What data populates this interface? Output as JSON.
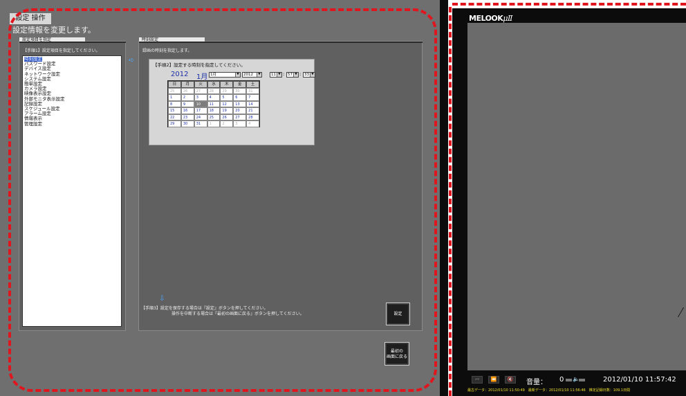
{
  "app": {
    "title": "設定 操作",
    "subtitle": "設定情報を変更します。"
  },
  "left_panel": {
    "tab": "設定項目を指定",
    "instruction": "【手順1】設定項目を指定してください。",
    "items": [
      "時刻設定",
      "パスワード設定",
      "デバイス設定",
      "ネットワーク設定",
      "システム設定",
      "簡単設定",
      "カメラ設定",
      "映像表示設定",
      "外部モニタ表示設定",
      "記録設定",
      "スケジュール設定",
      "アラーム設定",
      "情報表示",
      "管理設定"
    ],
    "selected_index": 0
  },
  "right_panel": {
    "tab": "時刻設定",
    "instruction": "録画の時刻を指定します。",
    "datetime": {
      "instruction": "【手順2】設定する時刻を指定してください。",
      "year": "2012",
      "month_label": "1月",
      "month_select": "1月",
      "year_select": "2012",
      "hour": "11",
      "minute": "57",
      "second": "33"
    },
    "calendar": {
      "weekdays": [
        "日",
        "月",
        "火",
        "水",
        "木",
        "金",
        "土"
      ],
      "weeks": [
        [
          "25",
          "26",
          "27",
          "28",
          "29",
          "30",
          "31"
        ],
        [
          "1",
          "2",
          "3",
          "4",
          "5",
          "6",
          "7"
        ],
        [
          "8",
          "9",
          "10",
          "11",
          "12",
          "13",
          "14"
        ],
        [
          "15",
          "16",
          "17",
          "18",
          "19",
          "20",
          "21"
        ],
        [
          "22",
          "23",
          "24",
          "25",
          "26",
          "27",
          "28"
        ],
        [
          "29",
          "30",
          "31",
          "1",
          "2",
          "3",
          "4"
        ]
      ],
      "today": "10"
    },
    "step3_line1": "【手順3】設定を保存する場合は『設定』ボタンを押してください。",
    "step3_line2": "操作を中断する場合は『最初の画面に戻る』ボタンを押してください。",
    "set_button": "設定"
  },
  "back_button": {
    "line1": "最初の",
    "line2": "画面に戻る"
  },
  "viewer": {
    "logo_text": "MELOOK",
    "logo_mu": "μⅡ",
    "volume_label": "音量：",
    "volume_value": "0",
    "timestamp": "2012/01/10 11:57:42",
    "status_line": "最古データ：2012/01/10 11:50:49　最新データ：2012/01/10 11:56:46　推定記録日数：109.1日間"
  },
  "colors": {
    "highlight": "#e0151d",
    "panel_bg": "#606060",
    "status_text": "#f0e030"
  }
}
